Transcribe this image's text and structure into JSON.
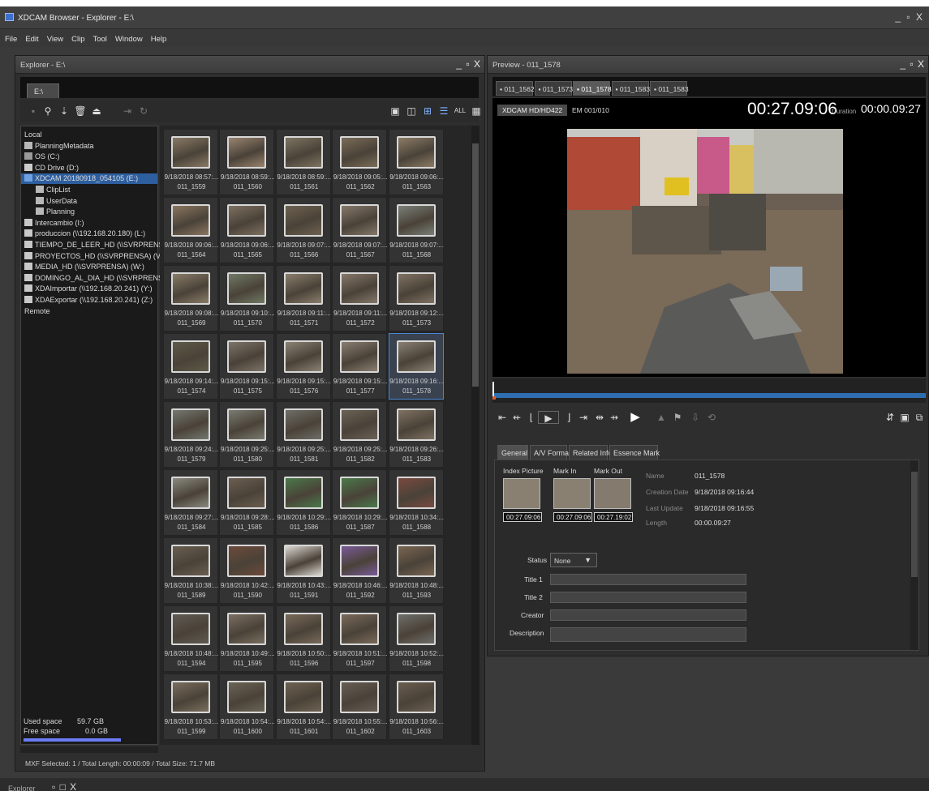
{
  "app": {
    "title": "XDCAM Browser - Explorer - E:\\",
    "window_controls": "_ ▫ X"
  },
  "menu": [
    "File",
    "Edit",
    "View",
    "Clip",
    "Tool",
    "Window",
    "Help"
  ],
  "explorer": {
    "title": "Explorer - E:\\",
    "controls": "_ ▫ X",
    "drive_tab": "E:\\",
    "tree": [
      {
        "label": "Local",
        "level": 0,
        "icon": "none-icon",
        "selected": false
      },
      {
        "label": "PlanningMetadata",
        "level": 0,
        "icon": "folder-icon",
        "selected": false
      },
      {
        "label": "OS (C:)",
        "level": 0,
        "icon": "drive-icon",
        "selected": false
      },
      {
        "label": "CD Drive (D:)",
        "level": 0,
        "icon": "cd-drive-icon",
        "selected": false
      },
      {
        "label": "XDCAM 20180918_054105 (E:)",
        "level": 0,
        "icon": "xdcam-drive-icon",
        "selected": true
      },
      {
        "label": "ClipList",
        "level": 1,
        "icon": "folder-icon",
        "selected": false
      },
      {
        "label": "UserData",
        "level": 1,
        "icon": "folder-icon",
        "selected": false
      },
      {
        "label": "Planning",
        "level": 1,
        "icon": "folder-icon",
        "selected": false
      },
      {
        "label": "Intercambio (I:)",
        "level": 0,
        "icon": "network-drive-icon",
        "selected": false
      },
      {
        "label": "produccion (\\\\192.168.20.180) (L:)",
        "level": 0,
        "icon": "network-drive-icon",
        "selected": false
      },
      {
        "label": "TIEMPO_DE_LEER_HD (\\\\SVRPRENSA) (U:)",
        "level": 0,
        "icon": "network-drive-icon",
        "selected": false
      },
      {
        "label": "PROYECTOS_HD (\\\\SVRPRENSA) (V:)",
        "level": 0,
        "icon": "network-drive-icon",
        "selected": false
      },
      {
        "label": "MEDIA_HD (\\\\SVRPRENSA) (W:)",
        "level": 0,
        "icon": "network-drive-icon",
        "selected": false
      },
      {
        "label": "DOMINGO_AL_DIA_HD (\\\\SVRPRENSA) (X:)",
        "level": 0,
        "icon": "network-drive-icon",
        "selected": false
      },
      {
        "label": "XDAImportar (\\\\192.168.20.241) (Y:)",
        "level": 0,
        "icon": "network-drive-icon",
        "selected": false
      },
      {
        "label": "XDAExportar (\\\\192.168.20.241) (Z:)",
        "level": 0,
        "icon": "network-drive-icon",
        "selected": false
      },
      {
        "label": "Remote",
        "level": 0,
        "icon": "none-icon",
        "selected": false
      }
    ],
    "space": {
      "used_label": "Used space",
      "used_value": "59.7 GB",
      "free_label": "Free space",
      "free_value": "0.0 GB"
    },
    "clips": [
      {
        "date": "9/18/2018 08:57:...",
        "name": "011_1559",
        "color": "#8a7a66"
      },
      {
        "date": "9/18/2018 08:59:...",
        "name": "011_1560",
        "color": "#9a8470"
      },
      {
        "date": "9/18/2018 08:59:...",
        "name": "011_1561",
        "color": "#7e7462"
      },
      {
        "date": "9/18/2018 09:05:...",
        "name": "011_1562",
        "color": "#7a6c58"
      },
      {
        "date": "9/18/2018 09:06:...",
        "name": "011_1563",
        "color": "#8c7c66"
      },
      {
        "date": "9/18/2018 09:06:...",
        "name": "011_1564",
        "color": "#8a7660"
      },
      {
        "date": "9/18/2018 09:06:...",
        "name": "011_1565",
        "color": "#7e7060"
      },
      {
        "date": "9/18/2018 09:07:...",
        "name": "011_1566",
        "color": "#6e6250"
      },
      {
        "date": "9/18/2018 09:07:...",
        "name": "011_1567",
        "color": "#85786a"
      },
      {
        "date": "9/18/2018 09:07:...",
        "name": "011_1568",
        "color": "#7a8078"
      },
      {
        "date": "9/18/2018 09:08:...",
        "name": "011_1569",
        "color": "#8a7c68"
      },
      {
        "date": "9/18/2018 09:10:...",
        "name": "011_1570",
        "color": "#6f7a64"
      },
      {
        "date": "9/18/2018 09:11:...",
        "name": "011_1571",
        "color": "#8a7e6c"
      },
      {
        "date": "9/18/2018 09:11:...",
        "name": "011_1572",
        "color": "#86786a"
      },
      {
        "date": "9/18/2018 09:12:...",
        "name": "011_1573",
        "color": "#807262"
      },
      {
        "date": "9/18/2018 09:14:...",
        "name": "011_1574",
        "color": "#5e5a48"
      },
      {
        "date": "9/18/2018 09:15:...",
        "name": "011_1575",
        "color": "#7c7468"
      },
      {
        "date": "9/18/2018 09:15:...",
        "name": "011_1576",
        "color": "#8c8274"
      },
      {
        "date": "9/18/2018 09:15:...",
        "name": "011_1577",
        "color": "#8a7e70"
      },
      {
        "date": "9/18/2018 09:16:...",
        "name": "011_1578",
        "color": "#8a8072"
      },
      {
        "date": "9/18/2018 09:24:...",
        "name": "011_1579",
        "color": "#747870"
      },
      {
        "date": "9/18/2018 09:25:...",
        "name": "011_1580",
        "color": "#7a7c72"
      },
      {
        "date": "9/18/2018 09:25:...",
        "name": "011_1581",
        "color": "#6e6e68"
      },
      {
        "date": "9/18/2018 09:25:...",
        "name": "011_1582",
        "color": "#6a6256"
      },
      {
        "date": "9/18/2018 09:26:...",
        "name": "011_1583",
        "color": "#7e7262"
      },
      {
        "date": "9/18/2018 09:27:...",
        "name": "011_1584",
        "color": "#8a8a80"
      },
      {
        "date": "9/18/2018 09:28:...",
        "name": "011_1585",
        "color": "#6c5e50"
      },
      {
        "date": "9/18/2018 10:29:...",
        "name": "011_1586",
        "color": "#4a7a4a"
      },
      {
        "date": "9/18/2018 10:29:...",
        "name": "011_1587",
        "color": "#4a7a4a"
      },
      {
        "date": "9/18/2018 10:34:...",
        "name": "011_1588",
        "color": "#7a4a40"
      },
      {
        "date": "9/18/2018 10:38:...",
        "name": "011_1589",
        "color": "#6a5e50"
      },
      {
        "date": "9/18/2018 10:42:...",
        "name": "011_1590",
        "color": "#6e4a3a"
      },
      {
        "date": "9/18/2018 10:43:...",
        "name": "011_1591",
        "color": "#dcd8d2"
      },
      {
        "date": "9/18/2018 10:46:...",
        "name": "011_1592",
        "color": "#7a5a9a"
      },
      {
        "date": "9/18/2018 10:48:...",
        "name": "011_1593",
        "color": "#7a6652"
      },
      {
        "date": "9/18/2018 10:48:...",
        "name": "011_1594",
        "color": "#5e5a52"
      },
      {
        "date": "9/18/2018 10:49:...",
        "name": "011_1595",
        "color": "#7a6e60"
      },
      {
        "date": "9/18/2018 10:50:...",
        "name": "011_1596",
        "color": "#786a5a"
      },
      {
        "date": "9/18/2018 10:51:...",
        "name": "011_1597",
        "color": "#7a6a5a"
      },
      {
        "date": "9/18/2018 10:52:...",
        "name": "011_1598",
        "color": "#6e6e6a"
      },
      {
        "date": "9/18/2018 10:53:...",
        "name": "011_1599",
        "color": "#7a6e5e"
      },
      {
        "date": "9/18/2018 10:54:...",
        "name": "011_1600",
        "color": "#6a6456"
      },
      {
        "date": "9/18/2018 10:54:...",
        "name": "011_1601",
        "color": "#6e6252"
      },
      {
        "date": "9/18/2018 10:55:...",
        "name": "011_1602",
        "color": "#665e54"
      },
      {
        "date": "9/18/2018 10:56:...",
        "name": "011_1603",
        "color": "#6a5e50"
      }
    ],
    "selected_clip": "011_1578",
    "status": "MXF Selected: 1 / Total Length: 00:00:09 / Total Size: 71.7 MB"
  },
  "preview": {
    "title": "Preview - 011_1578",
    "controls": "_ ▫ X",
    "tabs": [
      "011_1562",
      "011_1573",
      "011_1578",
      "011_1583",
      "011_1583"
    ],
    "active_tab": 2,
    "format": "XDCAM HD/HD422",
    "em": "EM 001/010",
    "timecode": "00:27.09:06",
    "duration_label": "Duration",
    "duration": "00:00.09:27",
    "info_tabs": [
      "General",
      "A/V Format",
      "Related Info",
      "Essence Mark"
    ],
    "info": {
      "index_picture_label": "Index Picture",
      "mark_in_label": "Mark In",
      "mark_out_label": "Mark Out",
      "index_tc": "00:27.09:06",
      "mark_in_tc": "00:27.09:06",
      "mark_out_tc": "00:27.19:02",
      "name_label": "Name",
      "name": "011_1578",
      "creation_label": "Creation Date",
      "creation": "9/18/2018 09:16:44",
      "update_label": "Last Update",
      "update": "9/18/2018 09:16:55",
      "length_label": "Length",
      "length": "00:00.09:27",
      "status_label": "Status",
      "status": "None",
      "title1_label": "Title 1",
      "title2_label": "Title 2",
      "creator_label": "Creator",
      "description_label": "Description"
    }
  },
  "bottom_tab": {
    "label": "Explorer",
    "controls": "▫ □ X"
  }
}
